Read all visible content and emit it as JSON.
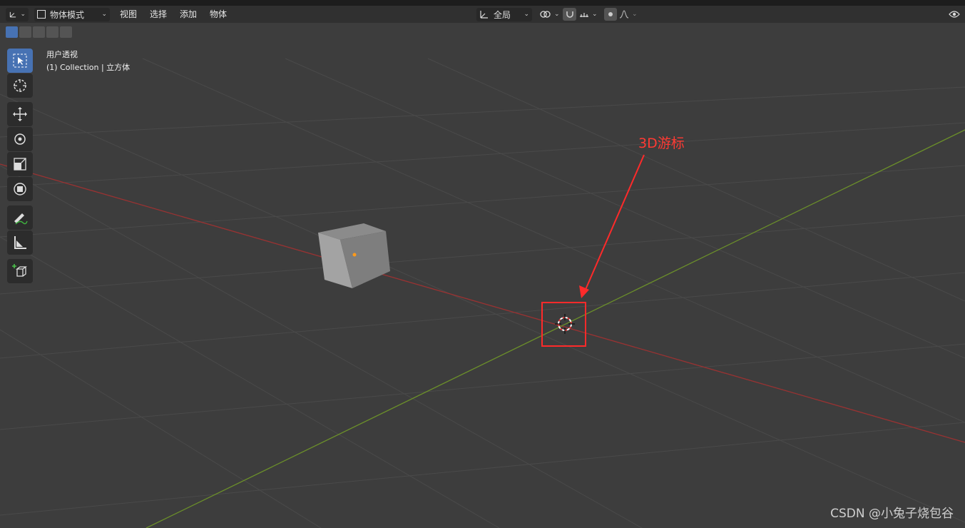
{
  "header": {
    "mode_label": "物体模式",
    "menu": [
      "视图",
      "选择",
      "添加",
      "物体"
    ],
    "transform_orientation": "全局"
  },
  "viewport": {
    "view_name": "用户透视",
    "collection_info": "(1) Collection | 立方体"
  },
  "annotation": {
    "label": "3D游标",
    "color": "#ff2a2a"
  },
  "icons": {
    "tools": [
      "select-box-icon",
      "cursor-icon",
      "move-icon",
      "rotate-icon",
      "scale-icon",
      "transform-icon",
      "annotate-icon",
      "measure-icon",
      "add-cube-icon"
    ]
  },
  "watermark": "CSDN @小兔子烧包谷",
  "colors": {
    "x_axis": "#9a3232",
    "y_axis": "#6b8f2a",
    "accent": "#4772b3"
  }
}
